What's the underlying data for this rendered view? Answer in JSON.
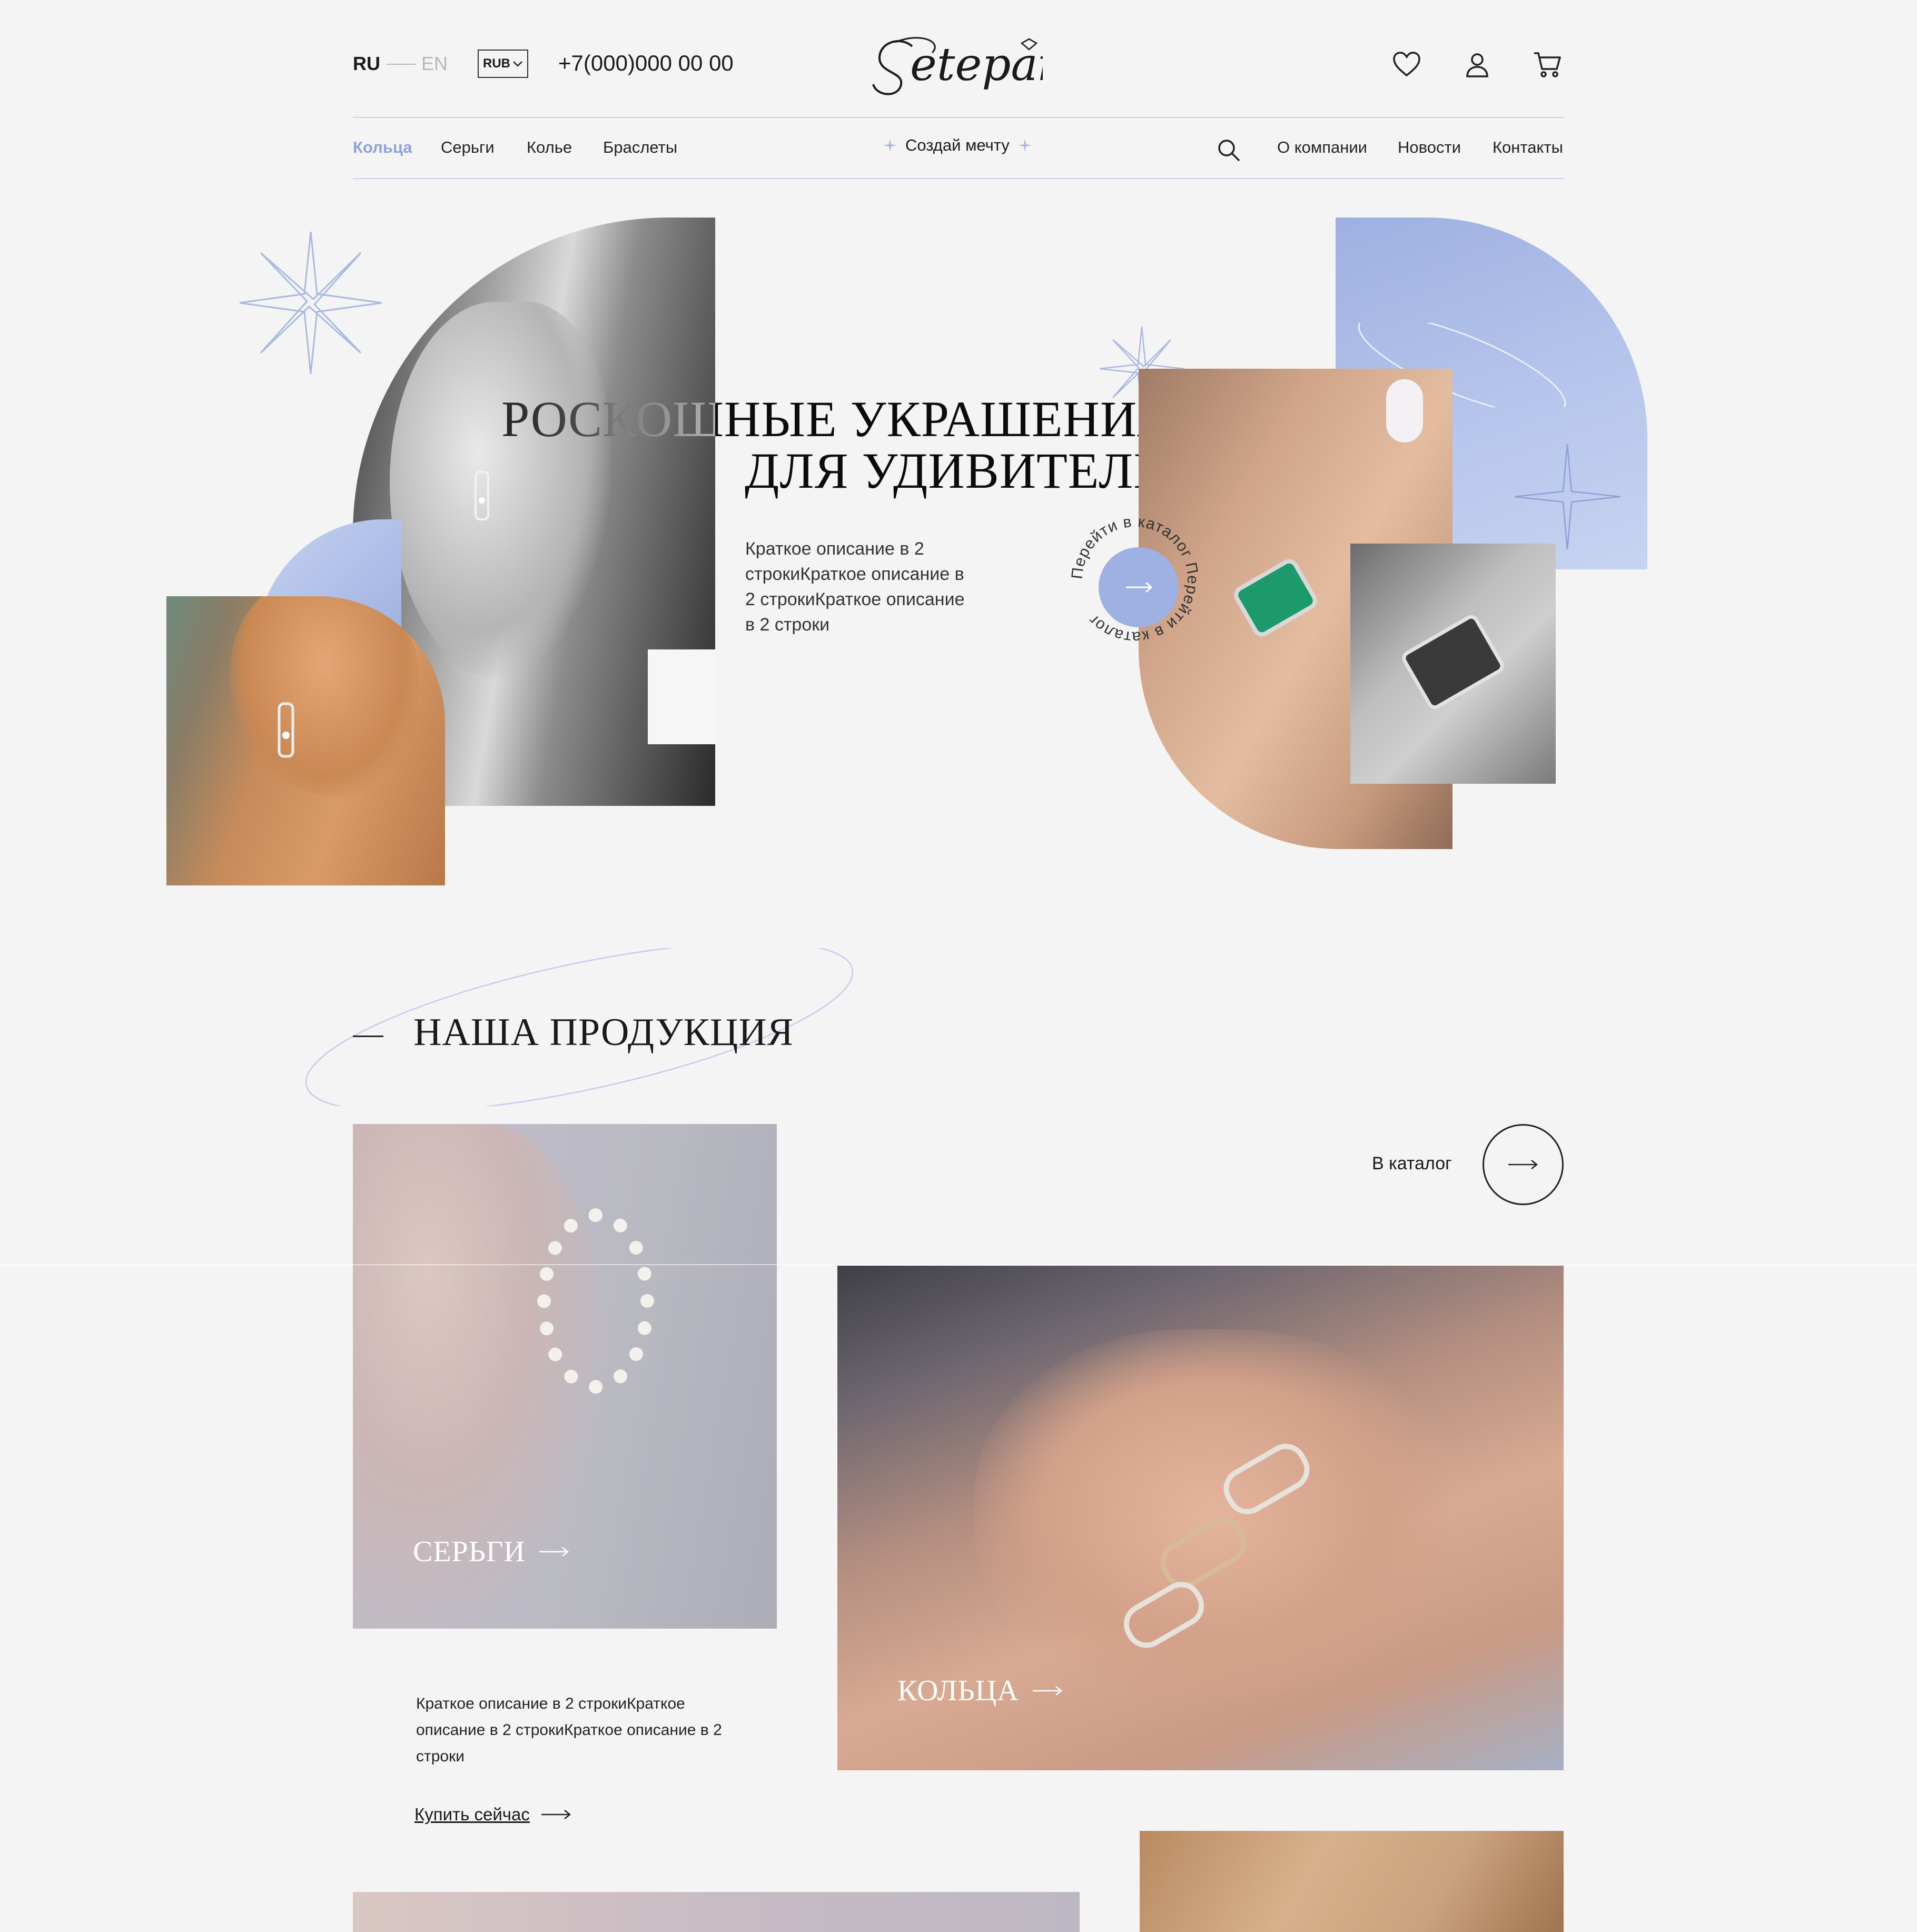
{
  "header": {
    "lang_active": "RU",
    "lang_other": "EN",
    "currency": "RUB",
    "phone": "+7(000)000 00 00",
    "logo_text": "Setepai"
  },
  "nav": {
    "left": [
      "Кольца",
      "Серьги",
      "Колье",
      "Браслеты"
    ],
    "center": "Создай мечту",
    "right": [
      "О компании",
      "Новости",
      "Контакты"
    ]
  },
  "hero": {
    "title_line1": "РОСКОШНЫЕ УКРАШЕНИЯ",
    "title_line2": "ДЛЯ УДИВИТЕЛЬНЫХ ДЕВУШЕК",
    "description": "Краткое описание в 2 строкиКраткое описание в 2 строкиКраткое описание в 2 строки",
    "circle_text": "Перейти в каталог Перейти в каталог "
  },
  "products": {
    "section_title": "НАША ПРОДУКЦИЯ",
    "catalog_label": "В каталог",
    "cards": [
      {
        "label": "СЕРЬГИ"
      },
      {
        "label": "КОЛЬЦА"
      }
    ],
    "description": "Краткое описание в 2 строкиКраткое описание в 2 строкиКраткое описание в 2 строки",
    "buy_label": "Купить сейчас"
  },
  "colors": {
    "accent": "#8ea3da",
    "accent_light": "#c3d0ec",
    "text": "#1a1a1a",
    "background": "#f4f4f4"
  },
  "icons": [
    "heart-icon",
    "user-icon",
    "cart-icon",
    "search-icon",
    "chevron-down-icon",
    "arrow-right-icon",
    "sparkle-icon"
  ]
}
